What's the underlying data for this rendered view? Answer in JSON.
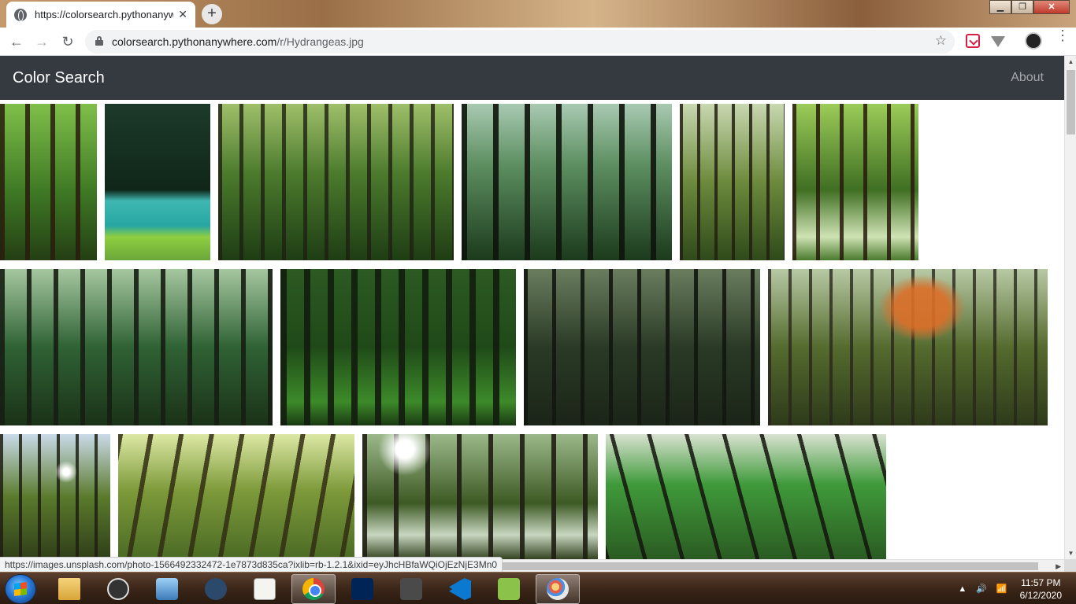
{
  "browser": {
    "tab_title": "https://colorsearch.pythonanywh",
    "tab_close": "✕",
    "new_tab": "+",
    "url_host": "colorsearch.pythonanywhere.com",
    "url_path": "/r/Hydrangeas.jpg",
    "back": "←",
    "forward": "→",
    "reload": "↻",
    "star": "☆",
    "menu": "⋮",
    "window_minimize": "▁",
    "window_maximize": "❐",
    "window_close": "✕",
    "status_url": "https://images.unsplash.com/photo-1566492332472-1e7873d835ca?ixlib=rb-1.2.1&ixid=eyJhcHBfaWQiOjEzNjE3Mn0"
  },
  "navbar": {
    "brand": "Color Search",
    "about": "About"
  },
  "gallery": {
    "photos": [
      {
        "name": "forest-photo-1",
        "style": "f1"
      },
      {
        "name": "forest-photo-2",
        "style": "f2"
      },
      {
        "name": "forest-photo-3",
        "style": "f3"
      },
      {
        "name": "forest-photo-4",
        "style": "f4"
      },
      {
        "name": "forest-photo-5",
        "style": "f5"
      },
      {
        "name": "forest-photo-6",
        "style": "f6"
      },
      {
        "name": "forest-photo-7",
        "style": "f7"
      },
      {
        "name": "forest-photo-8",
        "style": "f8"
      },
      {
        "name": "forest-photo-9",
        "style": "f9"
      },
      {
        "name": "forest-photo-10",
        "style": "f10"
      },
      {
        "name": "forest-photo-11",
        "style": "f11"
      },
      {
        "name": "forest-photo-12",
        "style": "f12"
      },
      {
        "name": "forest-photo-13",
        "style": "f13"
      },
      {
        "name": "forest-photo-14",
        "style": "f14"
      }
    ]
  },
  "taskbar": {
    "items": [
      {
        "name": "file-explorer-icon",
        "icon": "folder"
      },
      {
        "name": "obs-icon",
        "icon": "obs"
      },
      {
        "name": "control-panel-icon",
        "icon": "ctrl"
      },
      {
        "name": "kmplayer-icon",
        "icon": "kmp"
      },
      {
        "name": "document-icon",
        "icon": "doc"
      },
      {
        "name": "chrome-icon",
        "icon": "chrome",
        "active": true
      },
      {
        "name": "powershell-icon",
        "icon": "ps"
      },
      {
        "name": "sublime-text-icon",
        "icon": "subl"
      },
      {
        "name": "vscode-icon",
        "icon": "vscode"
      },
      {
        "name": "lambda-app-icon",
        "icon": "lambda"
      },
      {
        "name": "paint-icon",
        "icon": "paint",
        "active": true
      }
    ],
    "tray_expand": "▲",
    "volume": "🔊",
    "signal": "📶",
    "time": "11:57 PM",
    "date": "6/12/2020"
  }
}
